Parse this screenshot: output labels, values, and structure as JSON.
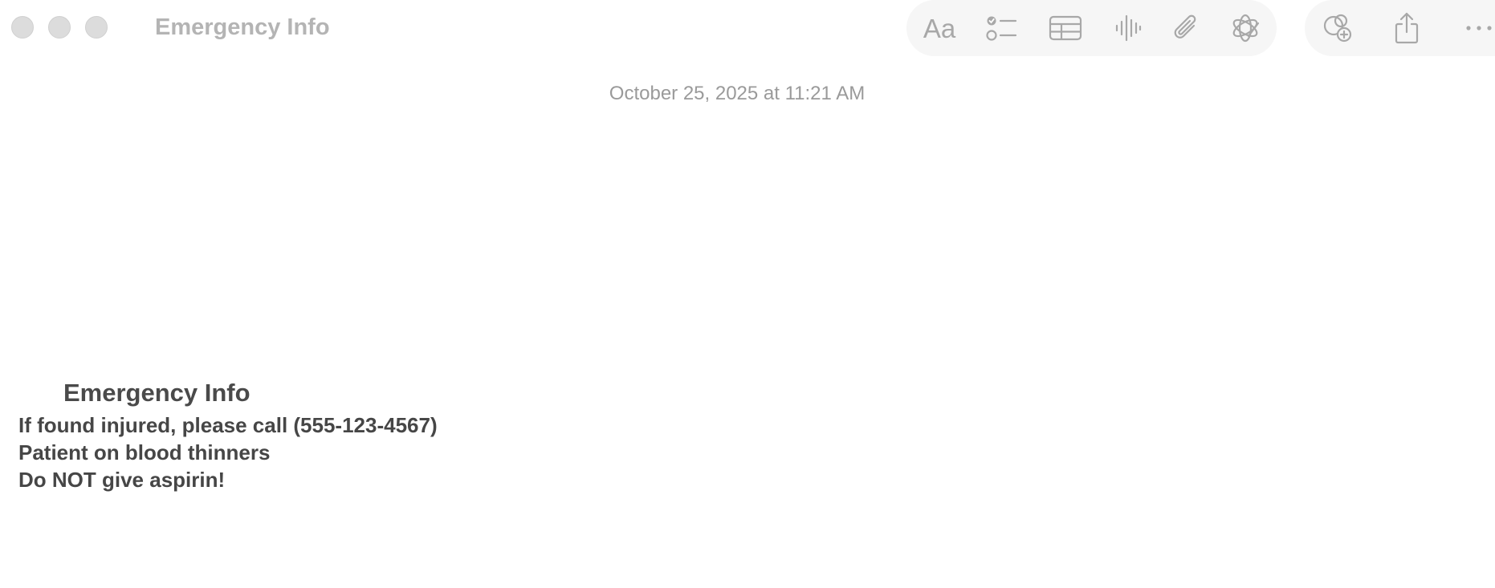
{
  "window": {
    "title": "Emergency Info"
  },
  "toolbar": {
    "format_label": "Aa",
    "icons": [
      "format-text-icon",
      "checklist-icon",
      "table-icon",
      "audio-waveform-icon",
      "paperclip-attachment-icon",
      "writing-tools-icon",
      "collaborate-icon",
      "share-icon",
      "more-icon"
    ]
  },
  "note": {
    "date": "October 25, 2025 at 11:21 AM",
    "heading": "Emergency Info",
    "lines": [
      "If found injured, please call (555-123-4567)",
      "Patient on blood thinners",
      "Do NOT give aspirin!"
    ]
  },
  "colors": {
    "title_text": "#b4b4b4",
    "toolbar_icon": "#a8a8a8",
    "toolbar_bg": "#f6f6f6",
    "date_text": "#9a9a9a",
    "body_text": "#464646",
    "traffic_light": "#dcdcdc"
  }
}
